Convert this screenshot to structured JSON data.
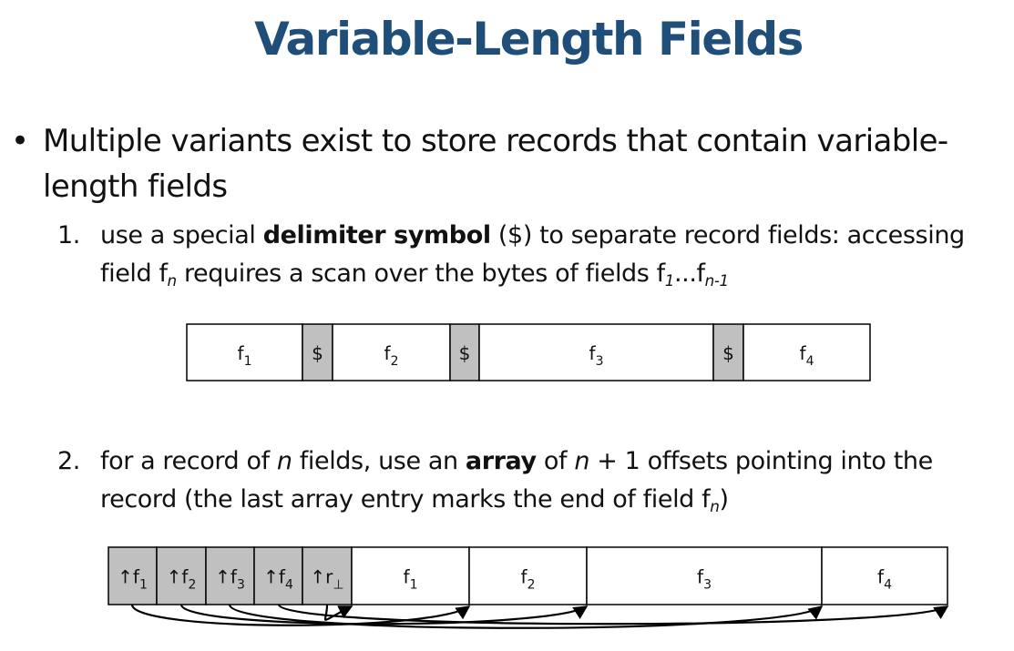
{
  "title": "Variable-Length Fields",
  "bullet": {
    "marker": "•",
    "text": "Multiple variants exist to store  records that contain variable-length fields"
  },
  "item1": {
    "number": "1.",
    "t1": "use a special ",
    "bold": "delimiter symbol",
    "t2": " ($) to separate record fields: accessing field f",
    "sub_n": "n",
    "t3": " requires a scan over the bytes of fields f",
    "sub_1": "1",
    "t4": "...f",
    "sub_n1": "n-1"
  },
  "item2": {
    "number": "2.",
    "t1": "for a record of ",
    "n1": "n",
    "t2": " fields, use an ",
    "bold": "array",
    "t3": " of ",
    "n2": "n",
    "t4": " + 1 offsets pointing into the record (the last array entry marks the end of field f",
    "sub_n": "n",
    "t5": ")"
  },
  "diagram1": {
    "cells": [
      {
        "kind": "field",
        "base": "f",
        "sub": "1"
      },
      {
        "kind": "delim",
        "base": "$",
        "sub": ""
      },
      {
        "kind": "field",
        "base": "f",
        "sub": "2"
      },
      {
        "kind": "delim",
        "base": "$",
        "sub": ""
      },
      {
        "kind": "field",
        "base": "f",
        "sub": "3"
      },
      {
        "kind": "delim",
        "base": "$",
        "sub": ""
      },
      {
        "kind": "field",
        "base": "f",
        "sub": "4"
      }
    ]
  },
  "diagram2": {
    "cells": [
      {
        "kind": "offset",
        "base": "↑f",
        "sub": "1"
      },
      {
        "kind": "offset",
        "base": "↑f",
        "sub": "2"
      },
      {
        "kind": "offset",
        "base": "↑f",
        "sub": "3"
      },
      {
        "kind": "offset",
        "base": "↑f",
        "sub": "4"
      },
      {
        "kind": "offset",
        "base": "↑r",
        "sub": "⊥"
      },
      {
        "kind": "field",
        "base": "f",
        "sub": "1"
      },
      {
        "kind": "field",
        "base": "f",
        "sub": "2"
      },
      {
        "kind": "field",
        "base": "f",
        "sub": "3"
      },
      {
        "kind": "field",
        "base": "f",
        "sub": "4"
      }
    ]
  },
  "colors": {
    "title": "#1f4e79",
    "shaded_cell": "#c0c0c0",
    "field_cell": "#ffffff"
  }
}
